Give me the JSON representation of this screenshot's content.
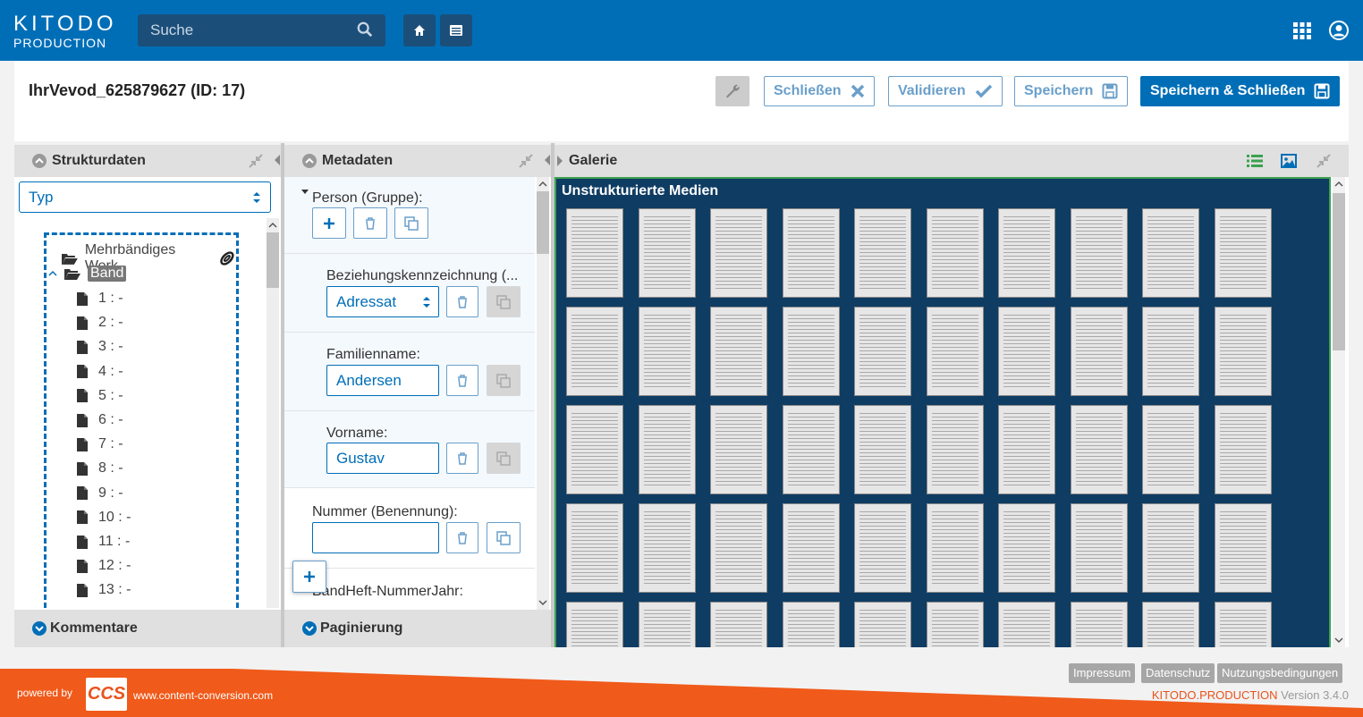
{
  "brand": {
    "line1": "KITODO",
    "line2": "PRODUCTION"
  },
  "search": {
    "placeholder": "Suche"
  },
  "header_icons": [
    "home-icon",
    "list-icon",
    "apps-grid-icon",
    "user-icon"
  ],
  "title": "IhrVevod_625879627 (ID: 17)",
  "toolbar": {
    "close_label": "Schließen",
    "validate_label": "Validieren",
    "save_label": "Speichern",
    "save_close_label": "Speichern & Schließen"
  },
  "structure": {
    "heading": "Strukturdaten",
    "type_select": "Typ",
    "root": "Mehrbändiges Werk",
    "child": "Band",
    "pages": [
      "1 : -",
      "2 : -",
      "3 : -",
      "4 : -",
      "5 : -",
      "6 : -",
      "7 : -",
      "8 : -",
      "9 : -",
      "10 : -",
      "11 : -",
      "12 : -",
      "13 : -"
    ],
    "footer": "Kommentare"
  },
  "metadata": {
    "heading": "Metadaten",
    "group": "Person (Gruppe):",
    "relation_label": "Beziehungskennzeichnung (...",
    "relation_value": "Adressat",
    "family_label": "Familienname:",
    "family_value": "Andersen",
    "first_label": "Vorname:",
    "first_value": "Gustav",
    "number_label": "Nummer (Benennung):",
    "number_value": "",
    "next_label": "BandHeft-NummerJahr:",
    "footer": "Paginierung"
  },
  "gallery": {
    "heading": "Galerie",
    "stripe_title": "Unstrukturierte Medien"
  },
  "footer": {
    "powered_by": "powered by",
    "ccs": "CCS",
    "url": "www.content-conversion.com",
    "links": [
      "Impressum",
      "Datenschutz",
      "Nutzungsbedingungen"
    ],
    "product": "KITODO.PRODUCTION",
    "version": "Version 3.4.0"
  },
  "colors": {
    "primary": "#006eb7",
    "footer_orange": "#f05a1a",
    "gallery_bg": "#0f3c63",
    "active_border": "#3ca14e"
  }
}
